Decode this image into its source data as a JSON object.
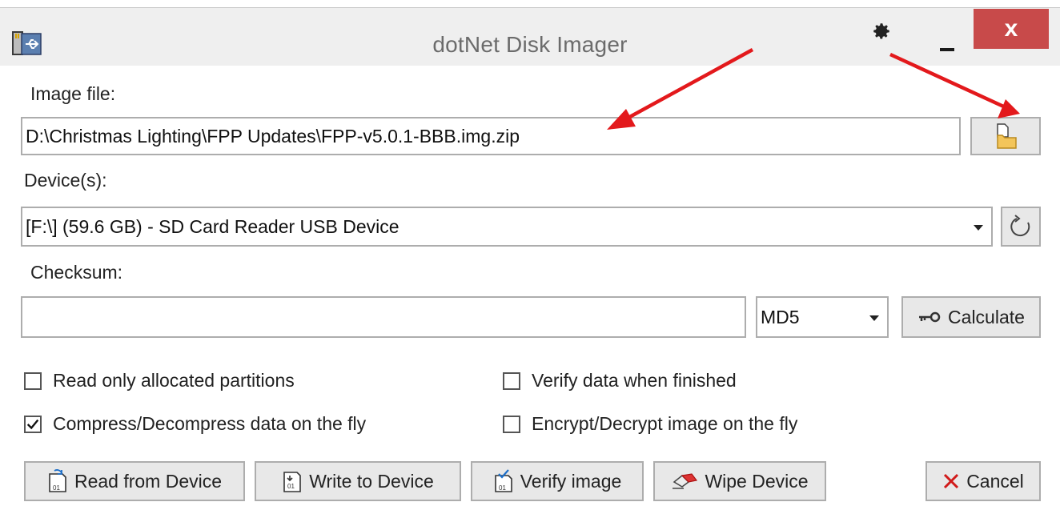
{
  "window": {
    "title": "dotNet Disk Imager",
    "close_label": "x"
  },
  "image_file": {
    "label": "Image file:",
    "value": "D:\\Christmas Lighting\\FPP Updates\\FPP-v5.0.1-BBB.img.zip"
  },
  "device": {
    "label": "Device(s):",
    "selected": "[F:\\] (59.6 GB) - SD Card Reader USB Device"
  },
  "checksum": {
    "label": "Checksum:",
    "value": "",
    "algorithm": "MD5",
    "calculate_label": "Calculate"
  },
  "options": {
    "read_only_allocated": {
      "label": "Read only allocated partitions",
      "checked": false
    },
    "verify_when_finished": {
      "label": "Verify data when finished",
      "checked": false
    },
    "compress_on_fly": {
      "label": "Compress/Decompress data on the fly",
      "checked": true
    },
    "encrypt_on_fly": {
      "label": "Encrypt/Decrypt image on the fly",
      "checked": false
    }
  },
  "actions": {
    "read_label": "Read from Device",
    "write_label": "Write to Device",
    "verify_label": "Verify image",
    "wipe_label": "Wipe Device",
    "cancel_label": "Cancel"
  },
  "icons": {
    "app": "sd-card-usb-icon",
    "settings": "gear-icon",
    "browse": "open-folder-icon",
    "refresh": "refresh-icon",
    "key": "key-icon",
    "read": "read-disk-icon",
    "write": "write-disk-icon",
    "verify": "verify-disk-icon",
    "wipe": "eraser-icon",
    "cancel": "close-x-icon"
  },
  "colors": {
    "annotation_arrow": "#e3191c",
    "close_button": "#c84a4a",
    "cancel_x": "#d11a1a"
  }
}
